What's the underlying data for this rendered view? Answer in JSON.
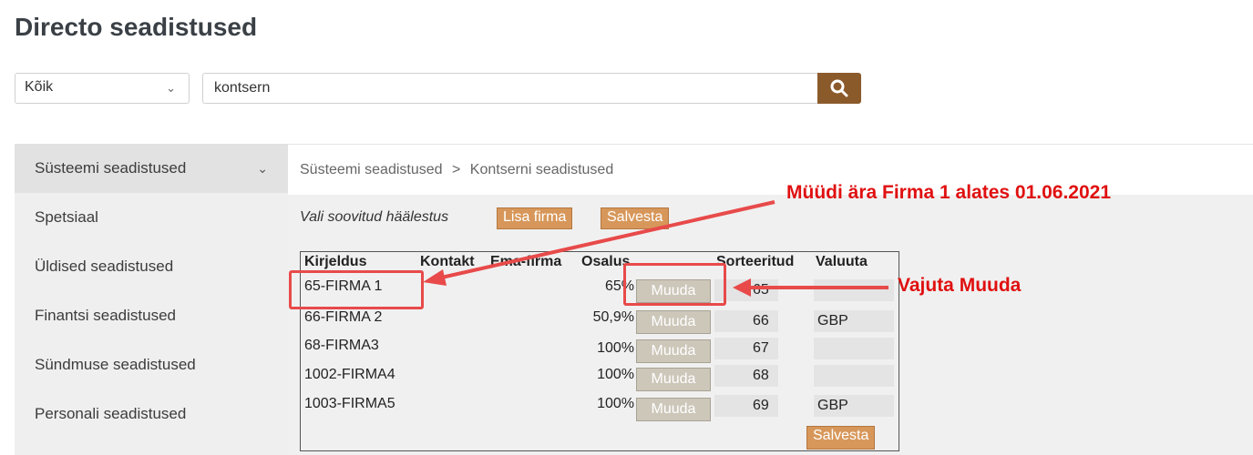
{
  "page_title": "Directo seadistused",
  "filter": {
    "selected": "Kõik"
  },
  "search": {
    "value": "kontsern"
  },
  "sidebar": {
    "items": [
      {
        "label": "Süsteemi seadistused"
      },
      {
        "label": "Spetsiaal"
      },
      {
        "label": "Üldised seadistused"
      },
      {
        "label": "Finantsi seadistused"
      },
      {
        "label": "Sündmuse seadistused"
      },
      {
        "label": "Personali seadistused"
      }
    ]
  },
  "breadcrumb": {
    "parent": "Süsteemi seadistused",
    "separator": ">",
    "current": "Kontserni seadistused"
  },
  "toolbar": {
    "preset_label": "Vali soovitud häälestus",
    "add_company": "Lisa firma",
    "save": "Salvesta"
  },
  "table": {
    "headers": [
      "Kirjeldus",
      "Kontakt",
      "Ema-firma",
      "Osalus",
      "Sorteeritud",
      "Valuuta"
    ],
    "rows": [
      {
        "description": "65-FIRMA 1",
        "share": "65%",
        "action": "Muuda",
        "sort": "65",
        "currency": ""
      },
      {
        "description": "66-FIRMA 2",
        "share": "50,9%",
        "action": "Muuda",
        "sort": "66",
        "currency": "GBP"
      },
      {
        "description": "68-FIRMA3",
        "share": "100%",
        "action": "Muuda",
        "sort": "67",
        "currency": ""
      },
      {
        "description": "1002-FIRMA4",
        "share": "100%",
        "action": "Muuda",
        "sort": "68",
        "currency": ""
      },
      {
        "description": "1003-FIRMA5",
        "share": "100%",
        "action": "Muuda",
        "sort": "69",
        "currency": "GBP"
      }
    ],
    "save": "Salvesta"
  },
  "annotations": {
    "sold_note": "Müüdi ära Firma 1 alates 01.06.2021",
    "click_note": "Vajuta Muuda",
    "color": "#e84a4a"
  },
  "colors": {
    "accent": "#8b5a2b",
    "button": "#d7975a",
    "muuda": "#cdc7ba"
  }
}
